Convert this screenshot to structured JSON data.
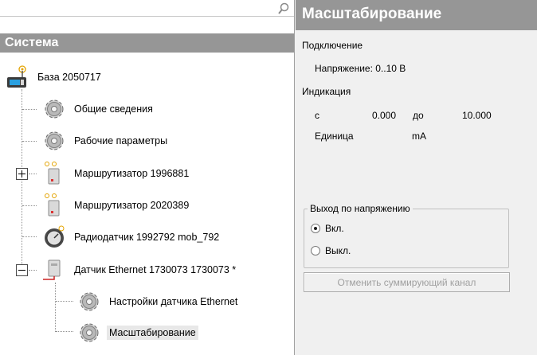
{
  "tree": {
    "header": "Система",
    "nodes": [
      {
        "label": "База 2050717",
        "icon": "base-station-icon"
      },
      {
        "label": "Общие сведения",
        "icon": "gear-icon"
      },
      {
        "label": "Рабочие параметры",
        "icon": "gear-icon"
      },
      {
        "label": "Маршрутизатор 1996881",
        "icon": "router-icon",
        "expander": "collapsed"
      },
      {
        "label": "Маршрутизатор 2020389",
        "icon": "router-icon"
      },
      {
        "label": "Радиодатчик 1992792 mob_792",
        "icon": "radio-sensor-icon"
      },
      {
        "label": "Датчик Ethernet 1730073 1730073 *",
        "icon": "ethernet-sensor-icon",
        "expander": "expanded"
      },
      {
        "label": "Настройки датчика Ethernet",
        "icon": "gear-icon"
      },
      {
        "label": "Масштабирование",
        "icon": "gear-icon",
        "selected": true
      }
    ]
  },
  "panel": {
    "title": "Масштабирование",
    "connection_label": "Подключение",
    "voltage_text": "Напряжение: 0..10 В",
    "indication_label": "Индикация",
    "from_label": "с",
    "from_value": "0.000",
    "to_label": "до",
    "to_value": "10.000",
    "unit_label": "Единица",
    "unit_value": "mA",
    "voltage_output": {
      "legend": "Выход по напряжению",
      "options": [
        {
          "label": "Вкл.",
          "checked": true
        },
        {
          "label": "Выкл.",
          "checked": false
        }
      ]
    },
    "cancel_button": "Отменить суммирующий канал"
  }
}
